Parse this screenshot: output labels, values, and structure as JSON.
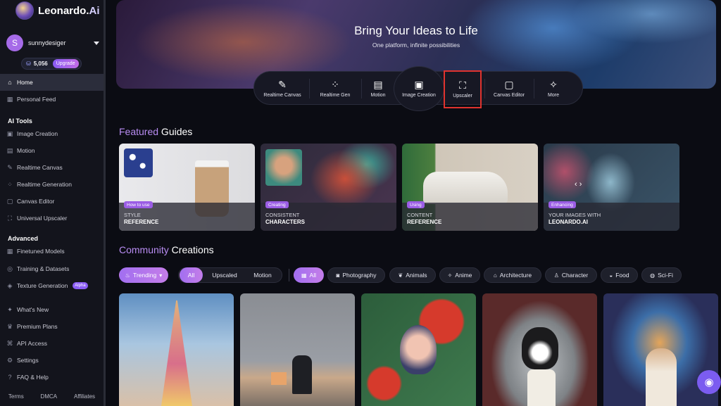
{
  "brand": {
    "name_main": "Leonardo.",
    "name_suffix": "Ai"
  },
  "user": {
    "initial": "S",
    "name": "sunnydesiger",
    "credits": "5,056",
    "upgrade_label": "Upgrade",
    "coin_icon": "coin-icon"
  },
  "nav": {
    "home": "Home",
    "personal_feed": "Personal Feed",
    "ai_tools_label": "AI Tools",
    "ai_tools": [
      "Image Creation",
      "Motion",
      "Realtime Canvas",
      "Realtime Generation",
      "Canvas Editor",
      "Universal Upscaler"
    ],
    "advanced_label": "Advanced",
    "advanced": [
      "Finetuned Models",
      "Training & Datasets",
      "Texture Generation"
    ],
    "alpha_badge": "Alpha",
    "misc": [
      "What's New",
      "Premium Plans",
      "API Access",
      "Settings",
      "FAQ & Help"
    ]
  },
  "footer": {
    "terms": "Terms",
    "dmca": "DMCA",
    "affiliates": "Affiliates"
  },
  "hero": {
    "title": "Bring Your Ideas to Life",
    "subtitle": "One platform, infinite possibilities"
  },
  "toolbar": {
    "tools": [
      "Realtime Canvas",
      "Realtime Gen",
      "Motion",
      "Image Creation",
      "Upscaler",
      "Canvas Editor",
      "More"
    ],
    "highlighted": "Upscaler"
  },
  "featured": {
    "title_accent": "Featured",
    "title_rest": " Guides",
    "cards": [
      {
        "tag": "How to use",
        "line1": "STYLE",
        "line2": "REFERENCE"
      },
      {
        "tag": "Creating",
        "line1": "CONSISTENT",
        "line2": "CHARACTERS"
      },
      {
        "tag": "Using",
        "line1": "CONTENT",
        "line2": "REFERENCE"
      },
      {
        "tag": "Enhancing",
        "line1": "YOUR IMAGES WITH",
        "line2": "LEONARDO.AI"
      }
    ]
  },
  "community": {
    "title_accent": "Community",
    "title_rest": " Creations",
    "sort": "Trending",
    "media": [
      "All",
      "Upscaled",
      "Motion"
    ],
    "categories": [
      "All",
      "Photography",
      "Animals",
      "Anime",
      "Architecture",
      "Character",
      "Food",
      "Sci-Fi"
    ]
  },
  "colors": {
    "accent": "#b88cf2",
    "highlight": "#e0332e",
    "sidebar_bg": "#13141c",
    "page_bg": "#0b0c13"
  }
}
